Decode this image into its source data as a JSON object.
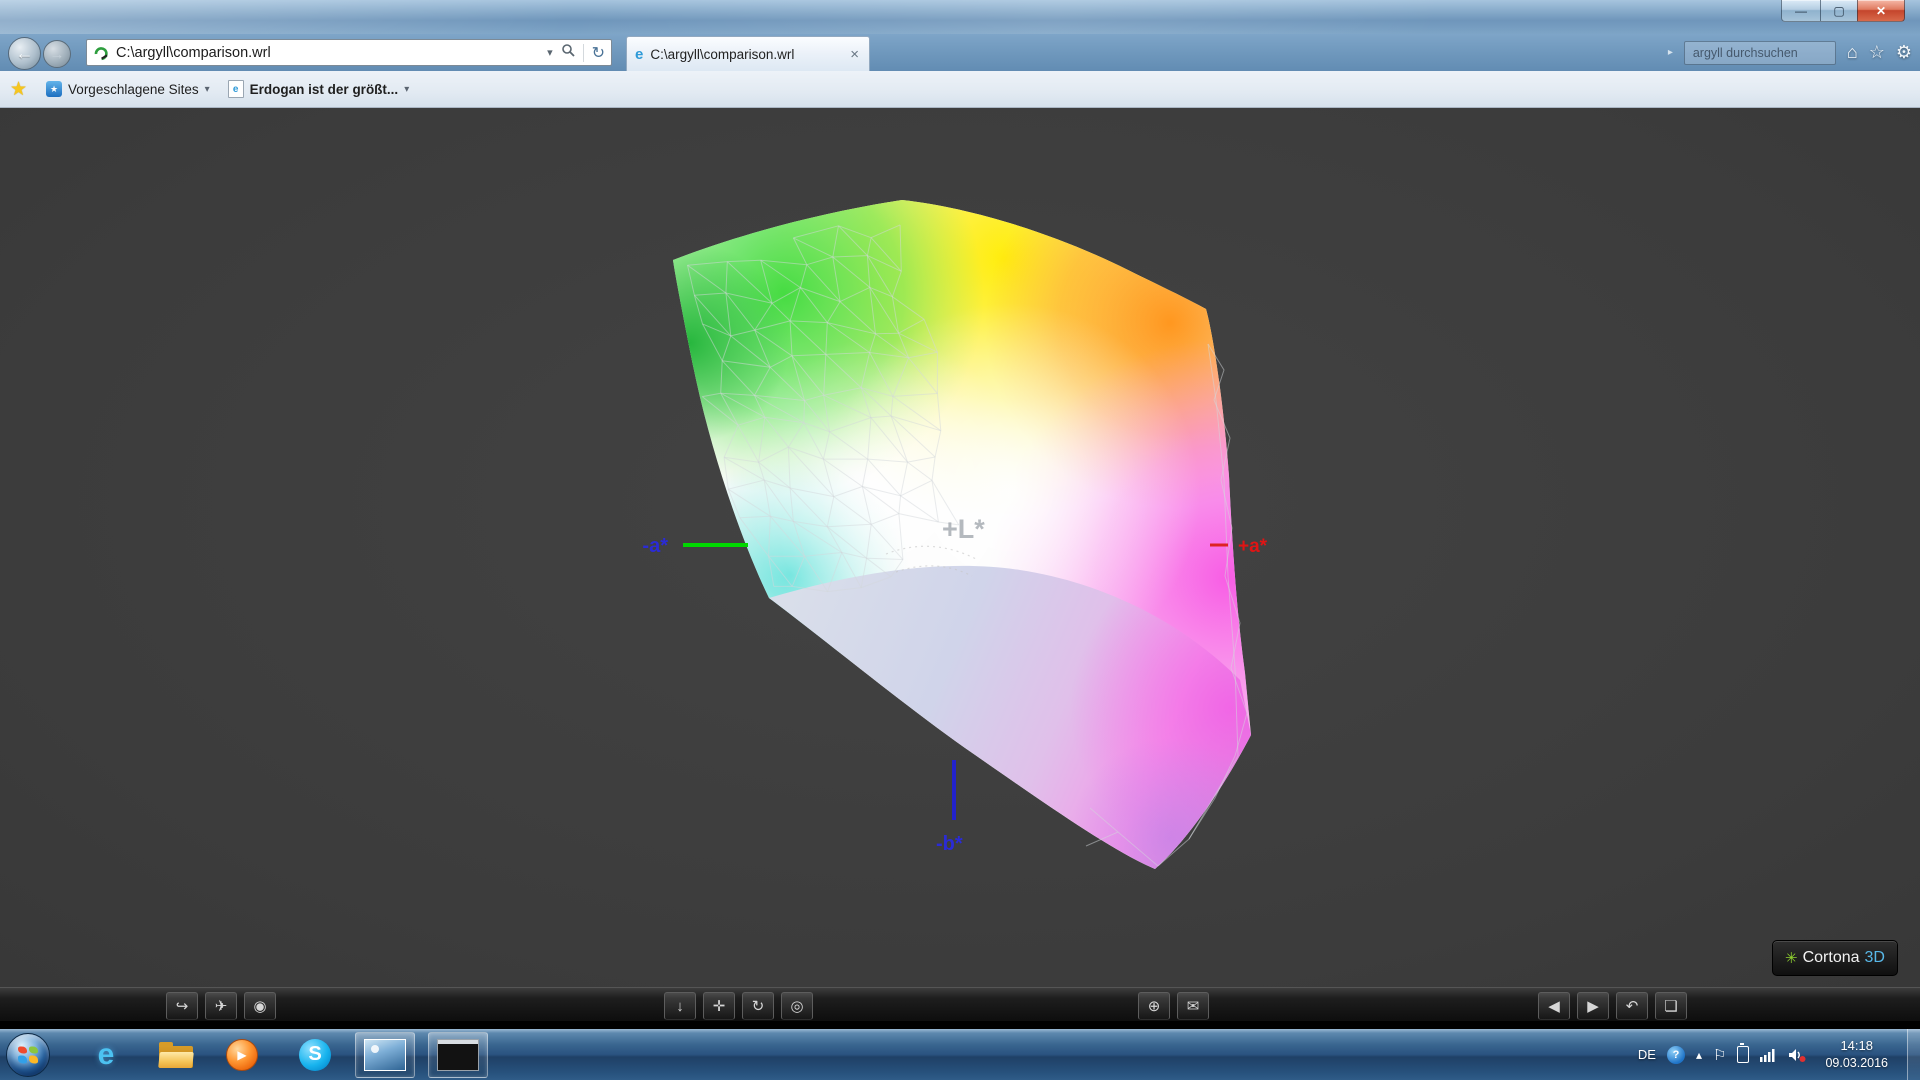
{
  "titlebar": {
    "minimize_glyph": "—",
    "maximize_glyph": "▢",
    "close_glyph": "✕"
  },
  "nav": {
    "back_glyph": "←",
    "forward_glyph": "→",
    "address": {
      "url": "C:\\argyll\\comparison.wrl",
      "dropdown_glyph": "▾",
      "refresh_glyph": "↻"
    },
    "tab": {
      "favicon_glyph": "e",
      "title": "C:\\argyll\\comparison.wrl",
      "close_glyph": "×"
    },
    "search": {
      "value": "argyll durchsuchen",
      "caret_glyph": "▸"
    },
    "home_glyph": "⌂",
    "favorites_glyph": "☆",
    "settings_glyph": "⚙"
  },
  "favorites_bar": {
    "star_glyph": "★",
    "items": [
      {
        "label": "Vorgeschlagene Sites",
        "caret": "▾"
      },
      {
        "label": "Erdogan ist der größt...",
        "caret": "▾"
      }
    ]
  },
  "viewer": {
    "axes": {
      "neg_a": "-a*",
      "pos_a": "+a*",
      "pos_l": "+L*",
      "neg_b": "-b*"
    },
    "logo": {
      "icon_glyph": "✳",
      "name": "Cortona",
      "suffix": "3D"
    },
    "toolbar": {
      "nav_group": [
        {
          "name": "walk",
          "glyph": "↪"
        },
        {
          "name": "fly",
          "glyph": "✈"
        },
        {
          "name": "examine",
          "glyph": "◉"
        }
      ],
      "move_group": [
        {
          "name": "goto",
          "glyph": "↓"
        },
        {
          "name": "pan",
          "glyph": "✛"
        },
        {
          "name": "turn",
          "glyph": "↻"
        },
        {
          "name": "spin",
          "glyph": "◎"
        }
      ],
      "view_group": [
        {
          "name": "fit",
          "glyph": "⊕"
        },
        {
          "name": "viewpoint",
          "glyph": "✉"
        }
      ],
      "history_group": [
        {
          "name": "prev-view",
          "glyph": "◀"
        },
        {
          "name": "next-view",
          "glyph": "▶"
        },
        {
          "name": "restore",
          "glyph": "↶"
        },
        {
          "name": "fullscreen",
          "glyph": "❏"
        }
      ]
    }
  },
  "taskbar": {
    "icons": {
      "ie_glyph": "e",
      "skype_glyph": "S",
      "media_glyph": "▶"
    },
    "tray": {
      "language": "DE",
      "help_glyph": "?",
      "chevron_glyph": "▴",
      "flag_glyph": "⚐",
      "time": "14:18",
      "date": "09.03.2016"
    }
  }
}
